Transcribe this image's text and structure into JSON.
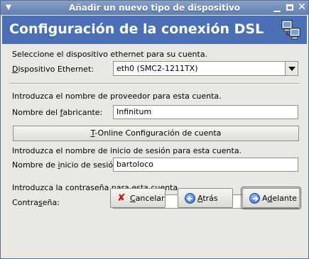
{
  "window": {
    "title": "Añadir un nuevo tipo de dispositivo",
    "menu_icon": "window-menu-icon",
    "minimize_icon": "minimize-icon",
    "maximize_icon": "maximize-icon",
    "close_icon": "close-icon"
  },
  "banner": {
    "heading": "Configuración de la conexión DSL",
    "icon": "network-computers-icon",
    "color": "#4a6fb5"
  },
  "ethernet": {
    "instruction": "Seleccione el dispositivo ethernet para su cuenta.",
    "label_mnemonic": "D",
    "label_rest": "ispositivo Ethernet:",
    "selected_value": "eth0 (SMC2-1211TX)"
  },
  "provider": {
    "instruction": "Introduzca el nombre de proveedor para esta cuenta.",
    "label_pre": "Nombre del ",
    "label_mnemonic": "f",
    "label_post": "abricante:",
    "value": "Infinitum",
    "tonline_mnemonic": "T",
    "tonline_rest": "-Online Configuración de cuenta"
  },
  "login": {
    "instruction": "Introduzca el nombre de inicio de sesión para esta cuenta.",
    "label_pre": "Nombre de ",
    "label_mnemonic": "i",
    "label_post": "nicio de sesión:",
    "value": "bartoloco"
  },
  "password": {
    "instruction": "Introduzca la contraseña para esta cuenta.",
    "label_pre": "Contra",
    "label_mnemonic": "s",
    "label_post": "eña:",
    "value": "*********"
  },
  "buttons": {
    "cancel_mnemonic": "C",
    "cancel_rest": "ancelar",
    "back_mnemonic": "A",
    "back_rest": "trás",
    "next_pre": "A",
    "next_mnemonic": "d",
    "next_rest": "elante"
  }
}
